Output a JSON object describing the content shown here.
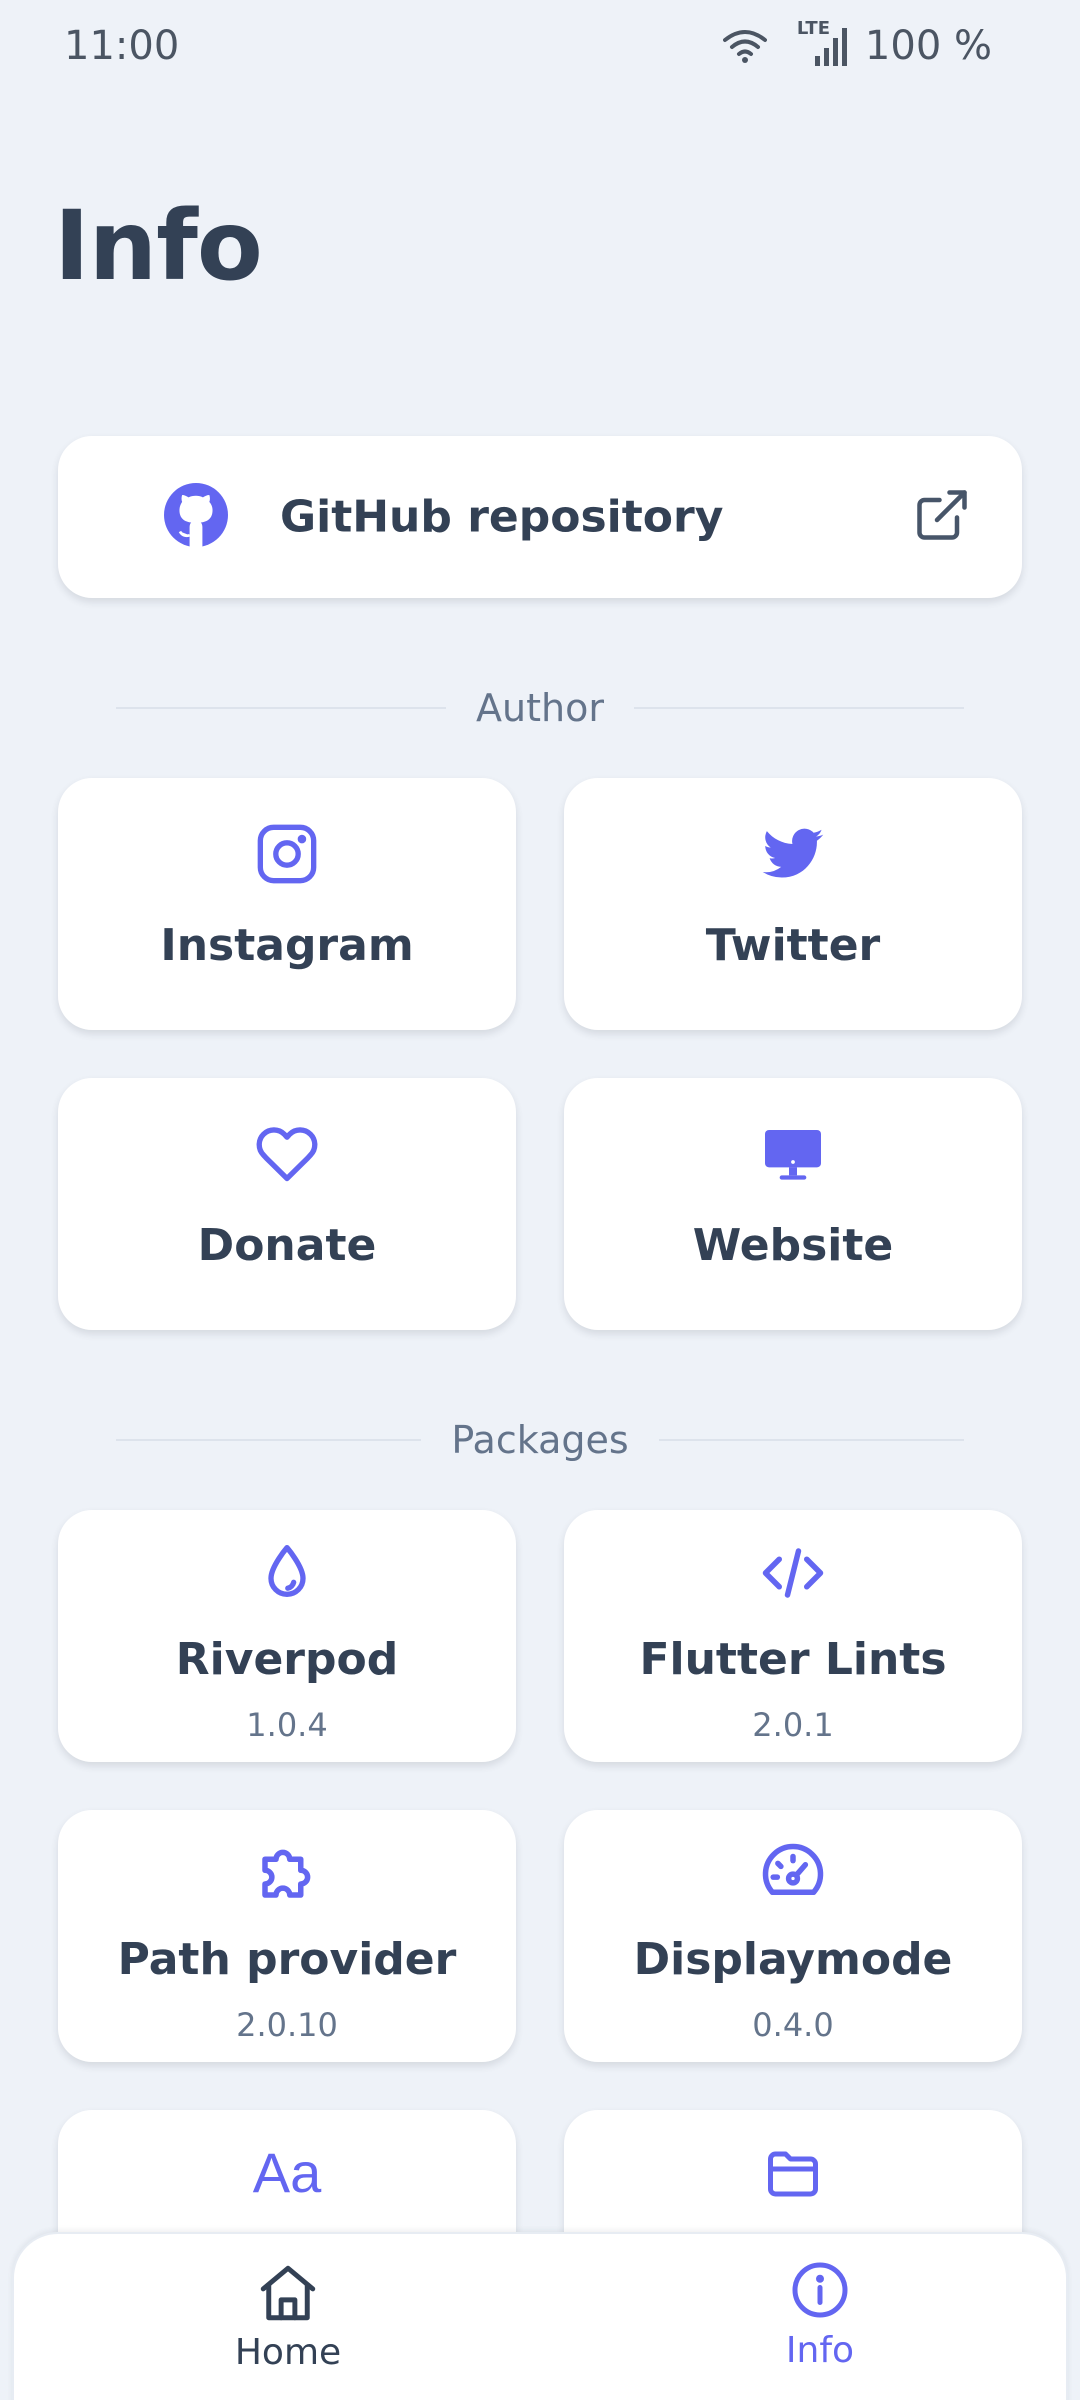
{
  "status_bar": {
    "time": "11:00",
    "battery": "100 %",
    "network_label": "LTE",
    "icons": [
      "wifi-icon",
      "signal-icon"
    ]
  },
  "page": {
    "title": "Info"
  },
  "github": {
    "label": "GitHub repository",
    "icon": "github-icon",
    "action_icon": "external-link-icon"
  },
  "sections": {
    "author": "Author",
    "packages": "Packages"
  },
  "author_links": [
    {
      "label": "Instagram",
      "icon": "instagram-icon"
    },
    {
      "label": "Twitter",
      "icon": "twitter-icon"
    },
    {
      "label": "Donate",
      "icon": "heart-icon"
    },
    {
      "label": "Website",
      "icon": "monitor-icon"
    }
  ],
  "packages": [
    {
      "name": "Riverpod",
      "version": "1.0.4",
      "icon": "droplet-icon"
    },
    {
      "name": "Flutter Lints",
      "version": "2.0.1",
      "icon": "code-icon"
    },
    {
      "name": "Path provider",
      "version": "2.0.10",
      "icon": "puzzle-icon"
    },
    {
      "name": "Displaymode",
      "version": "0.4.0",
      "icon": "gauge-icon"
    },
    {
      "name": "",
      "version": "",
      "icon": "font-icon"
    },
    {
      "name": "",
      "version": "",
      "icon": "folder-icon"
    }
  ],
  "nav": {
    "items": [
      {
        "label": "Home",
        "icon": "home-icon",
        "active": false
      },
      {
        "label": "Info",
        "icon": "info-icon",
        "active": true
      }
    ]
  },
  "colors": {
    "accent": "#6366f1",
    "text": "#334155",
    "muted": "#64748b",
    "background": "#eef2f8",
    "card": "#ffffff"
  }
}
